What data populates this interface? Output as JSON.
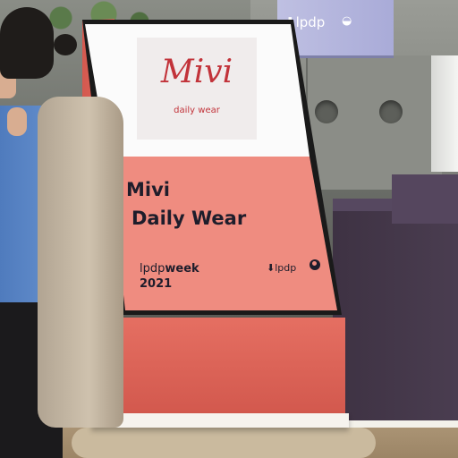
{
  "background_sign": {
    "logo_1": "⬇lpdp",
    "logo_2": "◒"
  },
  "screen": {
    "logo_card": {
      "wordmark": "Mivi",
      "tagline": "daily wear"
    },
    "headline": {
      "line_1": "Mivi",
      "line_2": "Daily Wear"
    },
    "event": {
      "brand_prefix": "lpdp",
      "brand_suffix": "week",
      "year": "2021"
    },
    "partner_logo": "⬇lpdp"
  },
  "colors": {
    "screen_pink": "#ef8c80",
    "logo_red": "#c2333a",
    "kiosk_coral": "#e56f62",
    "text_dark": "#1e1d2b"
  }
}
